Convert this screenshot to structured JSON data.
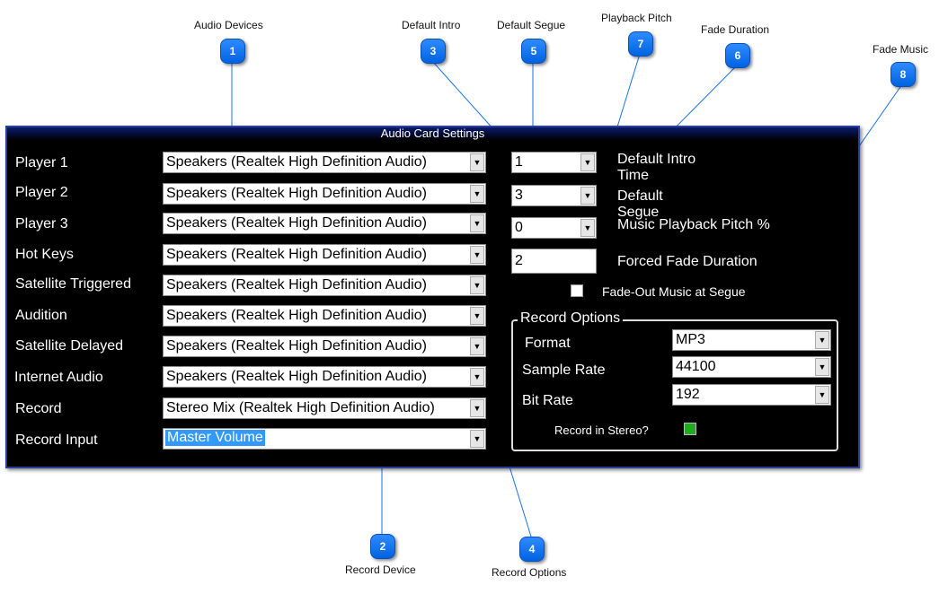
{
  "callouts": [
    {
      "num": "1",
      "label": "Audio Devices"
    },
    {
      "num": "2",
      "label": "Record Device"
    },
    {
      "num": "3",
      "label": "Default Intro"
    },
    {
      "num": "4",
      "label": "Record Options"
    },
    {
      "num": "5",
      "label": "Default Segue"
    },
    {
      "num": "6",
      "label": "Fade Duration"
    },
    {
      "num": "7",
      "label": "Playback Pitch"
    },
    {
      "num": "8",
      "label": "Fade Music"
    }
  ],
  "panel": {
    "title": "Audio Card Settings",
    "rows": [
      {
        "label": "Player 1",
        "value": "Speakers (Realtek High Definition Audio)"
      },
      {
        "label": "Player 2",
        "value": "Speakers (Realtek High Definition Audio)"
      },
      {
        "label": "Player 3",
        "value": "Speakers (Realtek High Definition Audio)"
      },
      {
        "label": "Hot Keys",
        "value": "Speakers (Realtek High Definition Audio)"
      },
      {
        "label": "Satellite Triggered",
        "value": "Speakers (Realtek High Definition Audio)"
      },
      {
        "label": "Audition",
        "value": "Speakers (Realtek High Definition Audio)"
      },
      {
        "label": "Satellite Delayed",
        "value": "Speakers (Realtek High Definition Audio)"
      },
      {
        "label": "Internet Audio",
        "value": "Speakers (Realtek High Definition Audio)"
      },
      {
        "label": "Record",
        "value": "Stereo Mix (Realtek High Definition Audio)"
      },
      {
        "label": "Record Input",
        "value": "Master Volume"
      }
    ],
    "intro": {
      "value": "1",
      "label": "Default Intro Time"
    },
    "segue": {
      "value": "3",
      "label": "Default Segue"
    },
    "pitch": {
      "value": "0",
      "label": "Music Playback Pitch %"
    },
    "fade": {
      "value": "2",
      "label": "Forced Fade Duration"
    },
    "fade_out": {
      "label": "Fade-Out Music at Segue",
      "checked": false
    },
    "record_options": {
      "legend": "Record Options",
      "format": {
        "label": "Format",
        "value": "MP3"
      },
      "sample_rate": {
        "label": "Sample Rate",
        "value": "44100"
      },
      "bit_rate": {
        "label": "Bit Rate",
        "value": "192"
      },
      "stereo": {
        "label": "Record in Stereo?",
        "checked": true,
        "color": "#22aa22"
      }
    }
  },
  "colors": {
    "panel_bg": "#000000",
    "badge": "#1a7cf5",
    "selection": "#3399ff",
    "leader": "#1a73e8"
  }
}
